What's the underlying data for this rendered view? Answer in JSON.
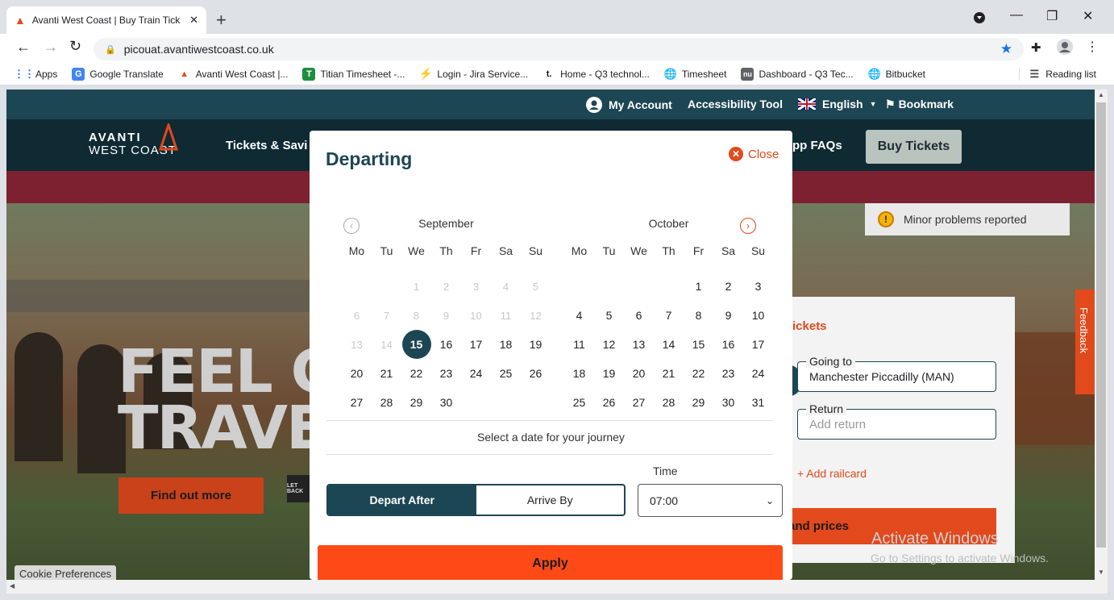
{
  "browser": {
    "tab_title": "Avanti West Coast | Buy Train Tick",
    "new_tab": "+",
    "url": "picouat.avantiwestcoast.co.uk",
    "bookmarks": [
      {
        "label": "Apps",
        "icon": "apps-grid-icon"
      },
      {
        "label": "Google Translate",
        "icon": "google-translate-icon"
      },
      {
        "label": "Avanti West Coast |...",
        "icon": "avanti-logo-icon"
      },
      {
        "label": "Titian Timesheet -...",
        "icon": "titian-icon"
      },
      {
        "label": "Login - Jira Service...",
        "icon": "jira-icon"
      },
      {
        "label": "Home - Q3 technol...",
        "icon": "q3-icon"
      },
      {
        "label": "Timesheet",
        "icon": "globe-icon"
      },
      {
        "label": "Dashboard - Q3 Tec...",
        "icon": "nu-icon"
      },
      {
        "label": "Bitbucket",
        "icon": "globe-icon"
      }
    ],
    "reading_list": "Reading list"
  },
  "site": {
    "top_links": {
      "account": "My Account",
      "accessibility": "Accessibility Tool",
      "language": "English",
      "bookmark": "Bookmark"
    },
    "logo_line1": "AVANTI",
    "logo_line2": "WEST COAST",
    "nav_tickets": "Tickets & Savi",
    "nav_faqs": "pp FAQs",
    "buy_tickets": "Buy Tickets",
    "status_notice": "Minor problems reported",
    "hero_line1": "FEEL GO",
    "hero_line2": "TRAVEL",
    "find_out_more": "Find out more",
    "cookie_prefs": "Cookie Preferences",
    "panel": {
      "heading": "tickets",
      "going_to_label": "Going to",
      "going_to_value": "Manchester Piccadilly (MAN)",
      "return_label": "Return",
      "return_placeholder": "Add return",
      "add_railcard": "+ Add railcard",
      "prices_button": "and prices"
    },
    "feedback": "Feedback",
    "watermark_title": "Activate Windows",
    "watermark_sub": "Go to Settings to activate Windows."
  },
  "modal": {
    "title": "Departing",
    "close": "Close",
    "weekdays": [
      "Mo",
      "Tu",
      "We",
      "Th",
      "Fr",
      "Sa",
      "Su"
    ],
    "months": [
      {
        "name": "September",
        "days": [
          {
            "d": "",
            "s": "empty"
          },
          {
            "d": "",
            "s": "empty"
          },
          {
            "d": "1",
            "s": "dis"
          },
          {
            "d": "2",
            "s": "dis"
          },
          {
            "d": "3",
            "s": "dis"
          },
          {
            "d": "4",
            "s": "dis"
          },
          {
            "d": "5",
            "s": "dis"
          },
          {
            "d": "6",
            "s": "dis"
          },
          {
            "d": "7",
            "s": "dis"
          },
          {
            "d": "8",
            "s": "dis"
          },
          {
            "d": "9",
            "s": "dis"
          },
          {
            "d": "10",
            "s": "dis"
          },
          {
            "d": "11",
            "s": "dis"
          },
          {
            "d": "12",
            "s": "dis"
          },
          {
            "d": "13",
            "s": "dis"
          },
          {
            "d": "14",
            "s": "dis"
          },
          {
            "d": "15",
            "s": "sel"
          },
          {
            "d": "16",
            "s": "on"
          },
          {
            "d": "17",
            "s": "on"
          },
          {
            "d": "18",
            "s": "on"
          },
          {
            "d": "19",
            "s": "on"
          },
          {
            "d": "20",
            "s": "on"
          },
          {
            "d": "21",
            "s": "on"
          },
          {
            "d": "22",
            "s": "on"
          },
          {
            "d": "23",
            "s": "on"
          },
          {
            "d": "24",
            "s": "on"
          },
          {
            "d": "25",
            "s": "on"
          },
          {
            "d": "26",
            "s": "on"
          },
          {
            "d": "27",
            "s": "on"
          },
          {
            "d": "28",
            "s": "on"
          },
          {
            "d": "29",
            "s": "on"
          },
          {
            "d": "30",
            "s": "on"
          }
        ]
      },
      {
        "name": "October",
        "days": [
          {
            "d": "",
            "s": "empty"
          },
          {
            "d": "",
            "s": "empty"
          },
          {
            "d": "",
            "s": "empty"
          },
          {
            "d": "",
            "s": "empty"
          },
          {
            "d": "1",
            "s": "on"
          },
          {
            "d": "2",
            "s": "on"
          },
          {
            "d": "3",
            "s": "on"
          },
          {
            "d": "4",
            "s": "on"
          },
          {
            "d": "5",
            "s": "on"
          },
          {
            "d": "6",
            "s": "on"
          },
          {
            "d": "7",
            "s": "on"
          },
          {
            "d": "8",
            "s": "on"
          },
          {
            "d": "9",
            "s": "on"
          },
          {
            "d": "10",
            "s": "on"
          },
          {
            "d": "11",
            "s": "on"
          },
          {
            "d": "12",
            "s": "on"
          },
          {
            "d": "13",
            "s": "on"
          },
          {
            "d": "14",
            "s": "on"
          },
          {
            "d": "15",
            "s": "on"
          },
          {
            "d": "16",
            "s": "on"
          },
          {
            "d": "17",
            "s": "on"
          },
          {
            "d": "18",
            "s": "on"
          },
          {
            "d": "19",
            "s": "on"
          },
          {
            "d": "20",
            "s": "on"
          },
          {
            "d": "21",
            "s": "on"
          },
          {
            "d": "22",
            "s": "on"
          },
          {
            "d": "23",
            "s": "on"
          },
          {
            "d": "24",
            "s": "on"
          },
          {
            "d": "25",
            "s": "on"
          },
          {
            "d": "26",
            "s": "on"
          },
          {
            "d": "27",
            "s": "on"
          },
          {
            "d": "28",
            "s": "on"
          },
          {
            "d": "29",
            "s": "on"
          },
          {
            "d": "30",
            "s": "on"
          },
          {
            "d": "31",
            "s": "on"
          }
        ]
      }
    ],
    "hint": "Select a date for your journey",
    "time_label": "Time",
    "depart_after": "Depart After",
    "arrive_by": "Arrive By",
    "time_value": "07:00",
    "apply": "Apply"
  },
  "colors": {
    "brand_teal": "#1d4655",
    "accent_orange": "#fe4a17",
    "selected_day": "#1d4655",
    "disabled_day": "#c8c8c8"
  }
}
